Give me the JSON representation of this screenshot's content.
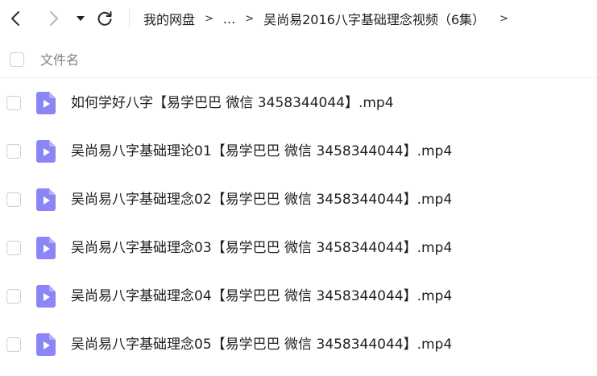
{
  "toolbar": {
    "back_icon": "chevron-left-icon",
    "forward_icon": "chevron-right-icon",
    "dropdown_icon": "caret-down-icon",
    "refresh_icon": "refresh-icon"
  },
  "breadcrumb": {
    "root": "我的网盘",
    "separator": ">",
    "ellipsis": "...",
    "current": "吴尚易2016八字基础理念视频（6集）",
    "tail_separator": ">"
  },
  "list_header": {
    "name_column": "文件名"
  },
  "files": [
    {
      "name": "如何学好八字【易学巴巴 微信 3458344044】.mp4",
      "type": "video"
    },
    {
      "name": "吴尚易八字基础理论01【易学巴巴 微信 3458344044】.mp4",
      "type": "video"
    },
    {
      "name": "吴尚易八字基础理念02【易学巴巴 微信 3458344044】.mp4",
      "type": "video"
    },
    {
      "name": "吴尚易八字基础理念03【易学巴巴 微信 3458344044】.mp4",
      "type": "video"
    },
    {
      "name": "吴尚易八字基础理念04【易学巴巴 微信 3458344044】.mp4",
      "type": "video"
    },
    {
      "name": "吴尚易八字基础理念05【易学巴巴 微信 3458344044】.mp4",
      "type": "video"
    }
  ],
  "colors": {
    "video_icon": "#8c85f6",
    "video_icon_fold": "#b4affa",
    "text": "#1f1f1f",
    "muted": "#808080"
  }
}
